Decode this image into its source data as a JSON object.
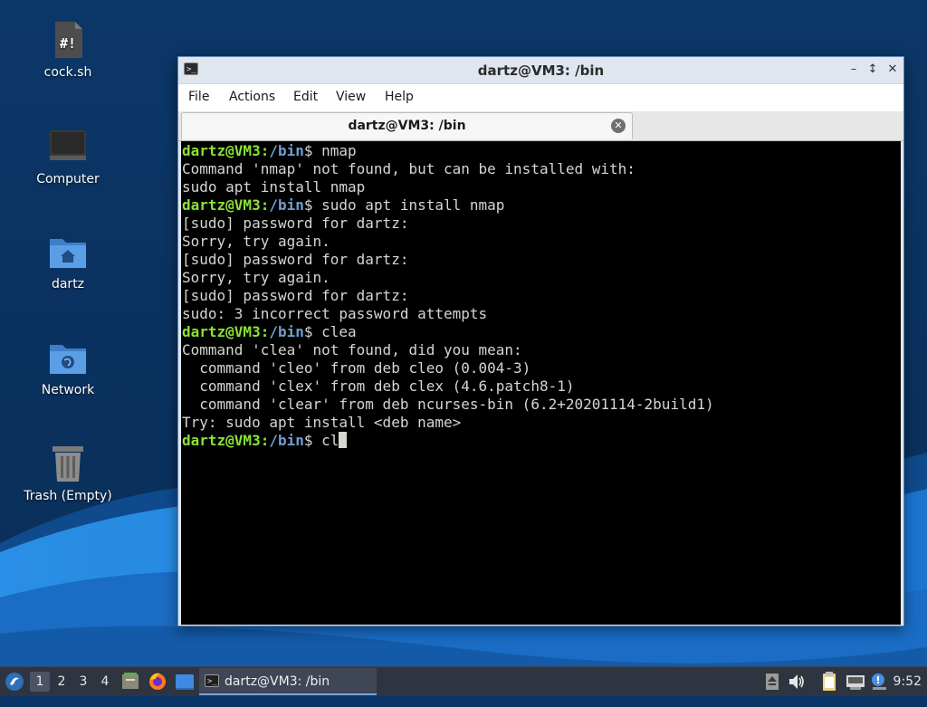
{
  "desktop": {
    "icons": [
      {
        "label": "cock.sh",
        "icon": "script-file-icon"
      },
      {
        "label": "Computer",
        "icon": "computer-icon"
      },
      {
        "label": "dartz",
        "icon": "home-folder-icon"
      },
      {
        "label": "Network",
        "icon": "network-folder-icon"
      },
      {
        "label": "Trash (Empty)",
        "icon": "trash-icon"
      }
    ],
    "colors": {
      "wallpaper_dark": "#0b3a6e",
      "wallpaper_wave": "#1f7fd8",
      "wallpaper_wave_light": "#2d95ec"
    }
  },
  "window": {
    "title": "dartz@VM3: /bin",
    "menu": [
      "File",
      "Actions",
      "Edit",
      "View",
      "Help"
    ],
    "tab_title": "dartz@VM3: /bin"
  },
  "terminal": {
    "prompt_user": "dartz@VM3",
    "prompt_path": "/bin",
    "lines": [
      {
        "type": "prompt",
        "cmd": "nmap"
      },
      {
        "type": "out",
        "text": "Command 'nmap' not found, but can be installed with:"
      },
      {
        "type": "out",
        "text": "sudo apt install nmap"
      },
      {
        "type": "prompt",
        "cmd": "sudo apt install nmap"
      },
      {
        "type": "out",
        "text": "[sudo] password for dartz:"
      },
      {
        "type": "out",
        "text": "Sorry, try again."
      },
      {
        "type": "out",
        "text": "[sudo] password for dartz:"
      },
      {
        "type": "out",
        "text": "Sorry, try again."
      },
      {
        "type": "out",
        "text": "[sudo] password for dartz:"
      },
      {
        "type": "out",
        "text": "sudo: 3 incorrect password attempts"
      },
      {
        "type": "prompt",
        "cmd": "clea"
      },
      {
        "type": "out",
        "text": "Command 'clea' not found, did you mean:"
      },
      {
        "type": "out",
        "text": "  command 'cleo' from deb cleo (0.004-3)"
      },
      {
        "type": "out",
        "text": "  command 'clex' from deb clex (4.6.patch8-1)"
      },
      {
        "type": "out",
        "text": "  command 'clear' from deb ncurses-bin (6.2+20201114-2build1)"
      },
      {
        "type": "out",
        "text": "Try: sudo apt install <deb name>"
      },
      {
        "type": "prompt",
        "cmd": "cl",
        "cursor": true
      }
    ],
    "colors": {
      "user": "#8ae234",
      "path": "#729fcf",
      "text": "#d3d7cf",
      "background": "#000000"
    }
  },
  "taskbar": {
    "workspaces": [
      "1",
      "2",
      "3",
      "4"
    ],
    "active_workspace": "1",
    "task_label": "dartz@VM3: /bin",
    "clock": "9:52",
    "tray_icons": [
      "upload-icon",
      "volume-icon",
      "clipboard-icon",
      "network-icon",
      "notification-icon"
    ]
  }
}
